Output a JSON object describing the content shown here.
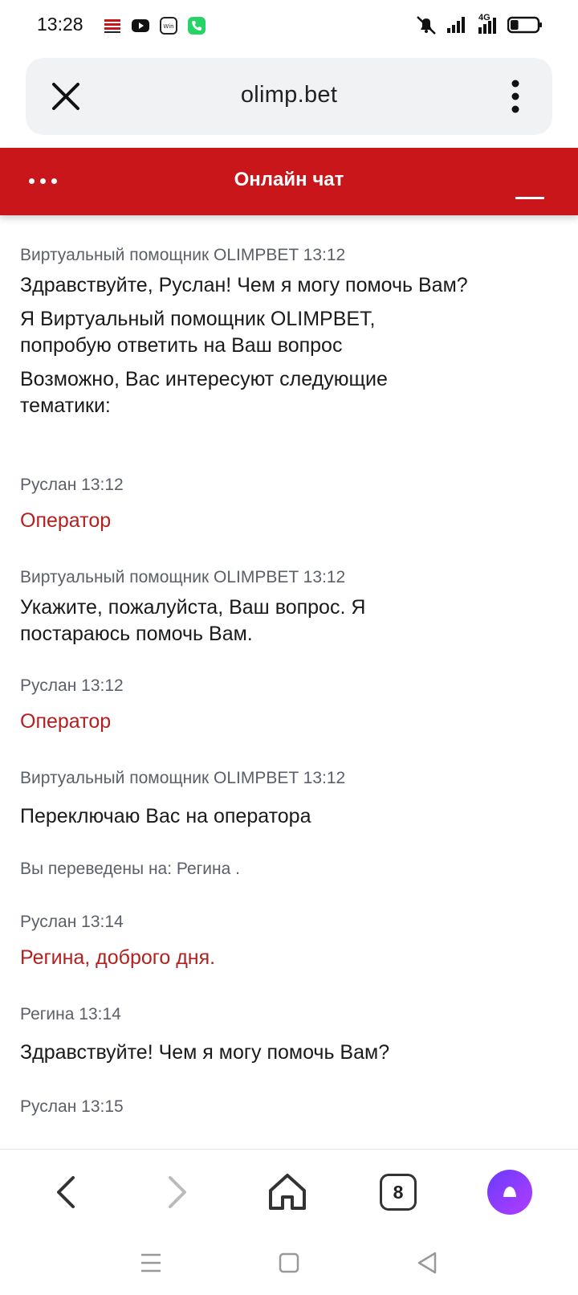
{
  "status_bar": {
    "time": "13:28",
    "network_label": "4G",
    "battery_level": 0.3
  },
  "browser": {
    "url": "olimp.bet"
  },
  "chat": {
    "title": "Онлайн чат"
  },
  "messages": [
    {
      "kind": "bot",
      "meta": "Виртуальный помощник OLIMPBET 13:12",
      "lines": [
        "Здравствуйте, Руслан! Чем я могу помочь Вам?",
        "Я Виртуальный помощник OLIMPBET, попробую ответить на Ваш вопрос",
        "Возможно, Вас интересуют следующие тематики:"
      ]
    },
    {
      "kind": "user",
      "meta": "Руслан 13:12",
      "text": "Оператор"
    },
    {
      "kind": "bot",
      "meta": "Виртуальный помощник OLIMPBET 13:12",
      "lines": [
        "Укажите, пожалуйста, Ваш вопрос. Я постараюсь помочь Вам."
      ]
    },
    {
      "kind": "user",
      "meta": "Руслан 13:12",
      "text": "Оператор"
    },
    {
      "kind": "bot",
      "meta": "Виртуальный помощник OLIMPBET 13:12",
      "lines": [
        "Переключаю Вас на оператора"
      ]
    },
    {
      "kind": "system",
      "text": "Вы переведены на: Регина ."
    },
    {
      "kind": "user",
      "meta": "Руслан 13:14",
      "text": "Регина, доброго дня."
    },
    {
      "kind": "operator",
      "meta": "Регина 13:14",
      "lines": [
        "Здравствуйте! Чем я могу помочь Вам?"
      ]
    },
    {
      "kind": "user",
      "meta": "Руслан 13:15",
      "text": ""
    }
  ],
  "bottom_nav": {
    "tabs_count": "8"
  },
  "colors": {
    "brand_red": "#c8161b",
    "user_text": "#b3201f",
    "meta_gray": "#5b6068"
  }
}
